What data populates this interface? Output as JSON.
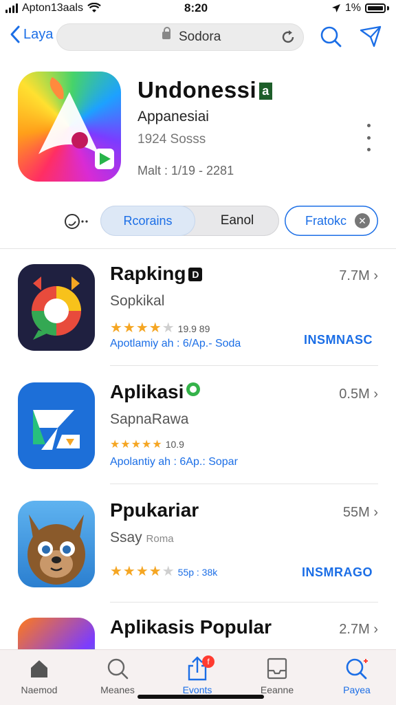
{
  "status_bar": {
    "carrier": "Apton13aals",
    "time": "8:20",
    "battery": "1%"
  },
  "nav": {
    "back_label": "Laya",
    "url": "Sodora"
  },
  "app_header": {
    "title": "Undonessi",
    "title_tag": "a",
    "developer": "Appanesiai",
    "meta": "1924 Sosss",
    "meta2": "Malt : 1/19 - 2281"
  },
  "segmented": {
    "option_a": "Rcorains",
    "option_b": "Eanol",
    "action_label": "Fratokc"
  },
  "list": [
    {
      "name": "Rapking",
      "badge": "D",
      "subtitle": "Sopkikal",
      "size": "7.7M",
      "stars": 4,
      "rating": "19.9 89",
      "developer": "Apotlamiy ah : 6/Ap.- Soda",
      "action": "INSMNASC"
    },
    {
      "name": "Aplikasi",
      "badge": "",
      "subtitle": "SapnaRawa",
      "size": "0.5M",
      "stars": 5,
      "rating": "10.9",
      "developer": "Apolantiy ah : 6Ap.: Sopar",
      "action": ""
    },
    {
      "name": "Ppukariar",
      "badge": "",
      "subtitle": "Ssay",
      "subtitle_small": "Roma",
      "size": "55M",
      "stars": 4,
      "rating": "55p : 38k",
      "developer": "",
      "action": "INSMRAGO"
    },
    {
      "name": "Aplikasis Popular",
      "badge": "",
      "subtitle": "",
      "size": "2.7M",
      "stars": 0,
      "rating": "",
      "developer": "",
      "action": ""
    }
  ],
  "tabbar": [
    {
      "label": "Naemod",
      "icon": "home-icon"
    },
    {
      "label": "Meanes",
      "icon": "search-icon"
    },
    {
      "label": "Evonts",
      "icon": "share-icon",
      "badge": "f"
    },
    {
      "label": "Eeanne",
      "icon": "tray-icon"
    },
    {
      "label": "Payea",
      "icon": "search-icon"
    }
  ],
  "colors": {
    "accent": "#1b6ee6",
    "star": "#f5a623",
    "notification": "#ff3b30"
  }
}
